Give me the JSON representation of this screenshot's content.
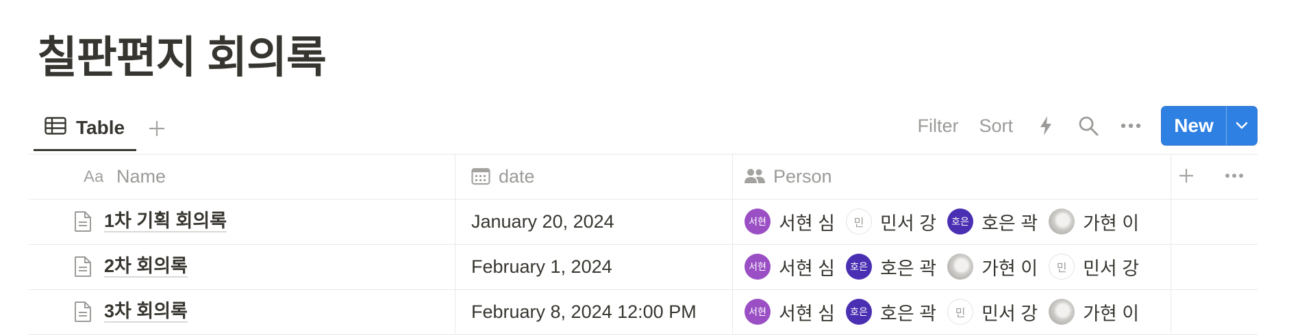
{
  "page": {
    "title": "칠판편지 회의록"
  },
  "views": {
    "active_tab": "Table",
    "tools": {
      "filter": "Filter",
      "sort": "Sort"
    },
    "new_button": "New"
  },
  "table": {
    "columns": [
      {
        "label": "Name",
        "icon": "text-type-icon"
      },
      {
        "label": "date",
        "icon": "calendar-icon"
      },
      {
        "label": "Person",
        "icon": "people-icon"
      }
    ],
    "rows": [
      {
        "name": "1차 기획 회의록",
        "date": "January 20, 2024",
        "people": [
          {
            "avatar": "서현",
            "name": "서현 심",
            "style": "purple"
          },
          {
            "avatar": "민",
            "name": "민서 강",
            "style": "plain"
          },
          {
            "avatar": "호은",
            "name": "호은 곽",
            "style": "indigo"
          },
          {
            "avatar": "",
            "name": "가현 이",
            "style": "photo"
          }
        ]
      },
      {
        "name": "2차 회의록",
        "date": "February 1, 2024",
        "people": [
          {
            "avatar": "서현",
            "name": "서현 심",
            "style": "purple"
          },
          {
            "avatar": "호은",
            "name": "호은 곽",
            "style": "indigo"
          },
          {
            "avatar": "",
            "name": "가현 이",
            "style": "photo"
          },
          {
            "avatar": "민",
            "name": "민서 강",
            "style": "plain"
          }
        ]
      },
      {
        "name": "3차 회의록",
        "date": "February 8, 2024 12:00 PM",
        "people": [
          {
            "avatar": "서현",
            "name": "서현 심",
            "style": "purple"
          },
          {
            "avatar": "호은",
            "name": "호은 곽",
            "style": "indigo"
          },
          {
            "avatar": "민",
            "name": "민서 강",
            "style": "plain"
          },
          {
            "avatar": "",
            "name": "가현 이",
            "style": "photo"
          }
        ]
      }
    ]
  }
}
